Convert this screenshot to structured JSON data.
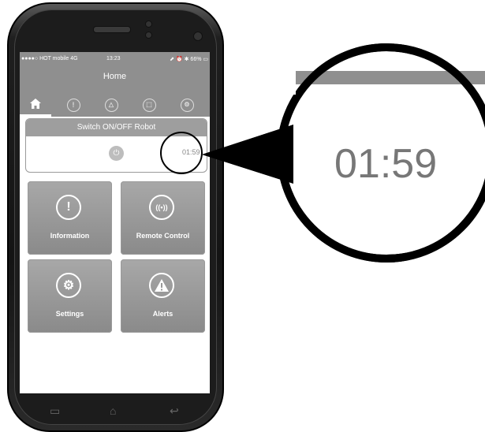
{
  "status_bar": {
    "carrier": "●●●●○ HOT mobile  4G",
    "time": "13:23",
    "right": "⬈ ⏰ ✱ 66% ▭"
  },
  "app": {
    "title": "Home"
  },
  "tabs": [
    {
      "icon": "home-icon",
      "glyph": "⌂"
    },
    {
      "icon": "info-icon",
      "glyph": "!"
    },
    {
      "icon": "alert-icon",
      "glyph": "△"
    },
    {
      "icon": "tag-icon",
      "glyph": "⬚"
    },
    {
      "icon": "settings-icon",
      "glyph": "⚙"
    }
  ],
  "switch": {
    "header": "Switch ON/OFF Robot",
    "timer": "01:59"
  },
  "tiles": [
    {
      "label": "Information",
      "glyph": "!"
    },
    {
      "label": "Remote Control",
      "glyph": "((•))"
    },
    {
      "label": "Settings",
      "glyph": "⚙"
    },
    {
      "label": "Alerts",
      "glyph": "!"
    }
  ],
  "zoom": {
    "text": "01:59"
  },
  "nav": {
    "menu": "▭",
    "home": "⌂",
    "back": "↩"
  }
}
